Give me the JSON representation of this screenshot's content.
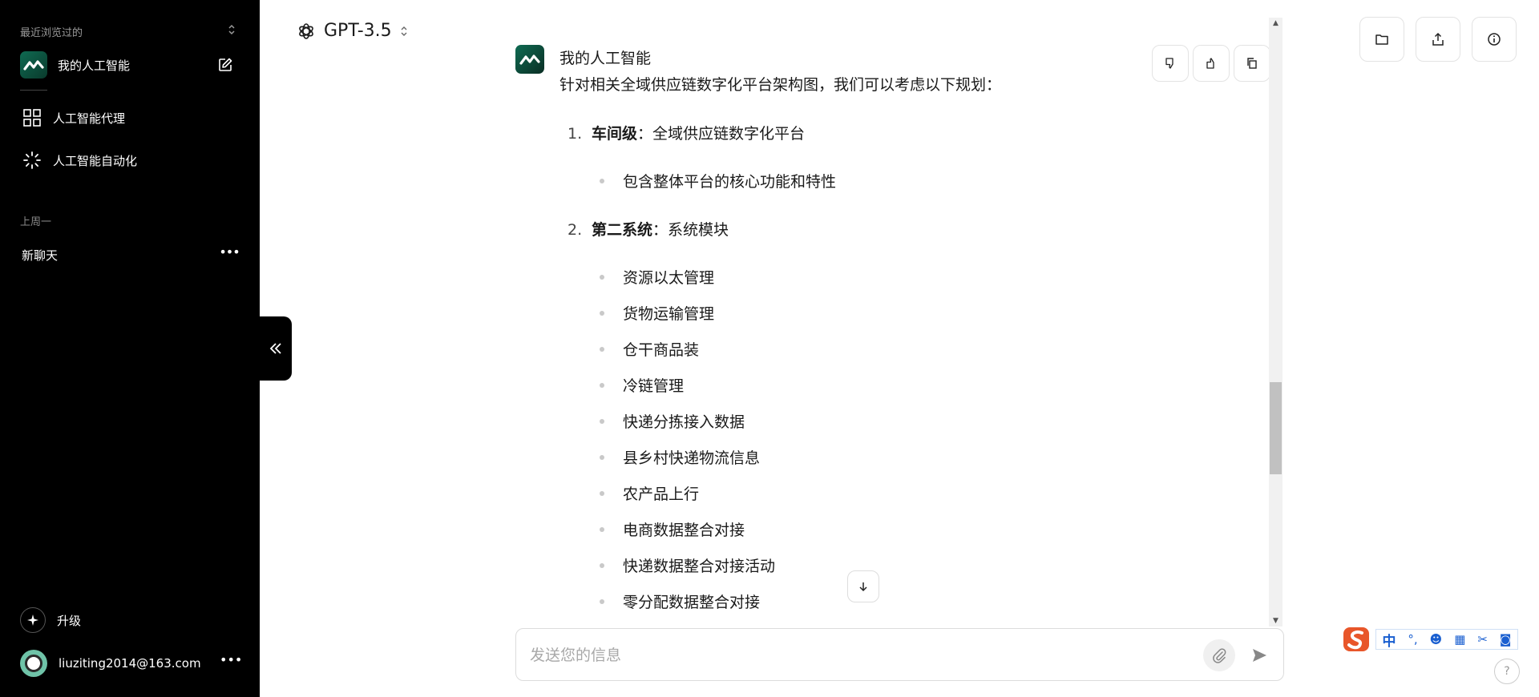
{
  "sidebar": {
    "recent_title": "最近浏览过的",
    "app_name": "我的人工智能",
    "nav": [
      {
        "label": "人工智能代理",
        "icon": "grid-icon"
      },
      {
        "label": "人工智能自动化",
        "icon": "loader-icon"
      }
    ],
    "week_label": "上周一",
    "chats": [
      {
        "label": "新聊天"
      }
    ],
    "upgrade_label": "升级",
    "user_email": "liuziting2014@163.com"
  },
  "header": {
    "model_name": "GPT-3.5"
  },
  "message": {
    "author": "我的人工智能",
    "intro": "针对相关全域供应链数字化平台架构图，我们可以考虑以下规划：",
    "sections": [
      {
        "number": "1.",
        "title": "车间级",
        "desc": "：全域供应链数字化平台",
        "bullets": [
          "包含整体平台的核心功能和特性"
        ]
      },
      {
        "number": "2.",
        "title": "第二系统",
        "desc": "：系统模块",
        "bullets": [
          "资源以太管理",
          "货物运输管理",
          "仓干商品装",
          "冷链管理",
          "快递分拣接入数据",
          "县乡村快递物流信息",
          "农产品上行",
          "电商数据整合对接",
          "快递数据整合对接活动",
          "零分配数据整合对接"
        ]
      }
    ]
  },
  "composer": {
    "placeholder": "发送您的信息"
  },
  "ime": {
    "lang": "中",
    "punct": "°,"
  },
  "help_label": "?",
  "colors": {
    "sidebar_bg": "#000000",
    "brand_green": "#0f6b52"
  }
}
